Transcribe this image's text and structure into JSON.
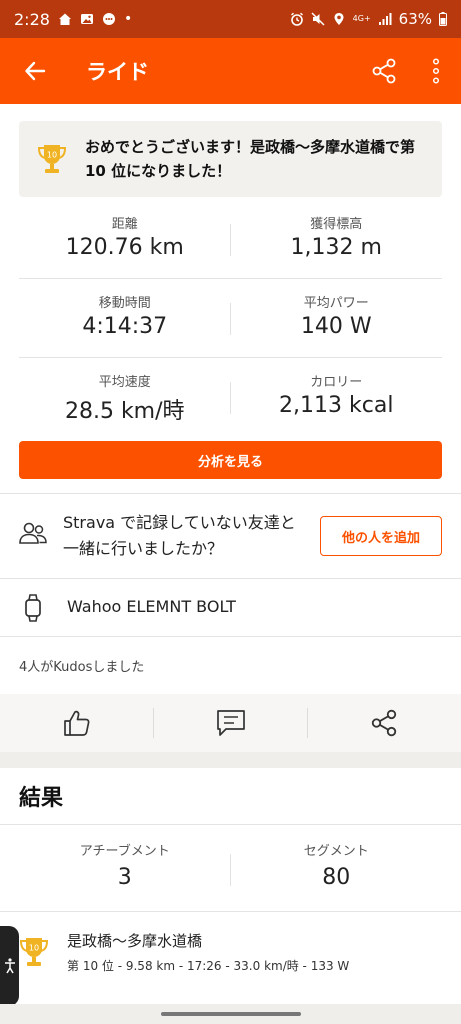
{
  "status_bar": {
    "time": "2:28",
    "network": "4G+",
    "battery": "63%"
  },
  "app_bar": {
    "title": "ライド"
  },
  "banner": {
    "text": "おめでとうございます！是政橋〜多摩水道橋で第 10 位になりました！",
    "trophy_rank": "10"
  },
  "stats": [
    [
      {
        "label": "距離",
        "value": "120.76 km"
      },
      {
        "label": "獲得標高",
        "value": "1,132 m"
      }
    ],
    [
      {
        "label": "移動時間",
        "value": "4:14:37"
      },
      {
        "label": "平均パワー",
        "value": "140 W"
      }
    ],
    [
      {
        "label": "平均速度",
        "value": "28.5 km/時"
      },
      {
        "label": "カロリー",
        "value": "2,113 kcal"
      }
    ]
  ],
  "analyze_button": "分析を見る",
  "friends": {
    "prompt": "Strava で記録していない友達と一緒に行いましたか？",
    "add_button": "他の人を追加"
  },
  "device": {
    "name": "Wahoo ELEMNT BOLT"
  },
  "kudos_text": "4人がKudosしました",
  "results": {
    "title": "結果",
    "achievements_label": "アチーブメント",
    "achievements_value": "3",
    "segments_label": "セグメント",
    "segments_value": "80"
  },
  "segment": {
    "name": "是政橋〜多摩水道橋",
    "detail": "第 10 位 - 9.58 km - 17:26 - 33.0 km/時 - 133 W",
    "trophy_rank": "10"
  },
  "colors": {
    "brand": "#fc5200",
    "status_bar": "#b8390d",
    "trophy": "#f0b323"
  }
}
